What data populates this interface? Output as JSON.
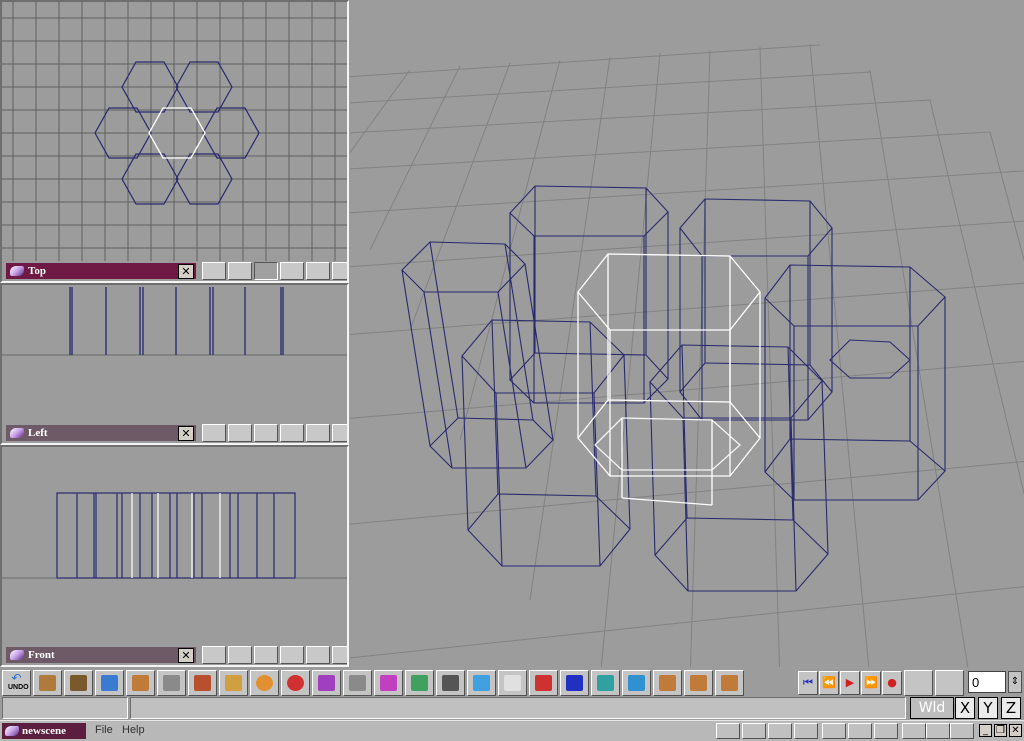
{
  "viewports": {
    "top": {
      "label": "Top",
      "close": "✕",
      "title_color": "#6e1a45"
    },
    "left": {
      "label": "Left",
      "close": "✕",
      "title_color": "#6e5a66"
    },
    "front": {
      "label": "Front",
      "close": "✕",
      "title_color": "#6e5a66"
    }
  },
  "toolbar": {
    "undo_label": "UNDO",
    "frame_value": "0",
    "buttons": [
      {
        "icon": "undo-icon",
        "color": "#2a6fd0"
      },
      {
        "icon": "cylinder-icon",
        "color": "#b07a3a"
      },
      {
        "icon": "camera-icon",
        "color": "#7a5a2a"
      },
      {
        "icon": "select-arrow-icon",
        "color": "#3a7ad0"
      },
      {
        "icon": "move-icon",
        "color": "#c07a3a"
      },
      {
        "icon": "grid-tile-icon",
        "color": "#8a8a8a"
      },
      {
        "icon": "box-icon",
        "color": "#b85030"
      },
      {
        "icon": "folder-icon",
        "color": "#d0a040"
      },
      {
        "icon": "sphere-icon",
        "color": "#e09030"
      },
      {
        "icon": "half-sphere-icon",
        "color": "#d03030"
      },
      {
        "icon": "blob-icon",
        "color": "#a040c0"
      },
      {
        "icon": "lathe-icon",
        "color": "#8a8a8a"
      },
      {
        "icon": "cone-icon",
        "color": "#c040c0"
      },
      {
        "icon": "cube-edit-icon",
        "color": "#40a060"
      },
      {
        "icon": "list-icon",
        "color": "#555555"
      },
      {
        "icon": "cube-blue-icon",
        "color": "#40a0e0"
      },
      {
        "icon": "figure-icon",
        "color": "#e0e0e0"
      },
      {
        "icon": "axes-icon",
        "color": "#d03030"
      },
      {
        "icon": "grid-icon",
        "color": "#2030c0"
      },
      {
        "icon": "plane-icon",
        "color": "#30a0a0"
      },
      {
        "icon": "3d-view-icon",
        "color": "#3090d0"
      },
      {
        "icon": "walk-icon",
        "color": "#c07a3a"
      },
      {
        "icon": "orbit-icon",
        "color": "#c07a3a"
      },
      {
        "icon": "zoom-icon",
        "color": "#c07a3a"
      }
    ]
  },
  "playback": [
    {
      "icon": "skip-start-icon",
      "glyph": "⏮",
      "color": "#2030c0"
    },
    {
      "icon": "rewind-icon",
      "glyph": "⏪",
      "color": "#2030c0"
    },
    {
      "icon": "play-icon",
      "glyph": "▶",
      "color": "#d02020"
    },
    {
      "icon": "fast-forward-icon",
      "glyph": "⏩",
      "color": "#2030c0"
    },
    {
      "icon": "record-icon",
      "glyph": "●",
      "color": "#d02020"
    }
  ],
  "axes": {
    "wld": "Wld",
    "x": "X",
    "y": "Y",
    "z": "Z"
  },
  "menubar": {
    "scene_name": "newscene",
    "file": "File",
    "help": "Help"
  }
}
